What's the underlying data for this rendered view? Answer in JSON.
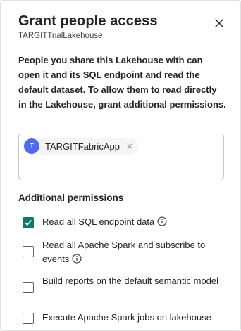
{
  "dialog": {
    "title": "Grant people access",
    "subtitle": "TARGITTrialLakehouse",
    "description": "People you share this Lakehouse with can open it and its SQL endpoint and read the default dataset. To allow them to read directly in the Lakehouse, grant additional permissions."
  },
  "people_picker": {
    "chips": [
      {
        "initial": "T",
        "name": "TARGITFabricApp",
        "avatar_color": "#4f6bed"
      }
    ],
    "input_value": ""
  },
  "permissions": {
    "header": "Additional permissions",
    "items": [
      {
        "label": "Read all SQL endpoint data",
        "checked": true,
        "has_info": true
      },
      {
        "label": "Read all Apache Spark and subscribe to events",
        "checked": false,
        "has_info": true
      },
      {
        "label": "Build reports on the default semantic model",
        "checked": false,
        "has_info": false
      },
      {
        "label": "Execute Apache Spark jobs on lakehouse",
        "checked": false,
        "has_info": false
      }
    ]
  },
  "colors": {
    "accent": "#117865",
    "avatar": "#4f6bed",
    "text": "#242424"
  }
}
